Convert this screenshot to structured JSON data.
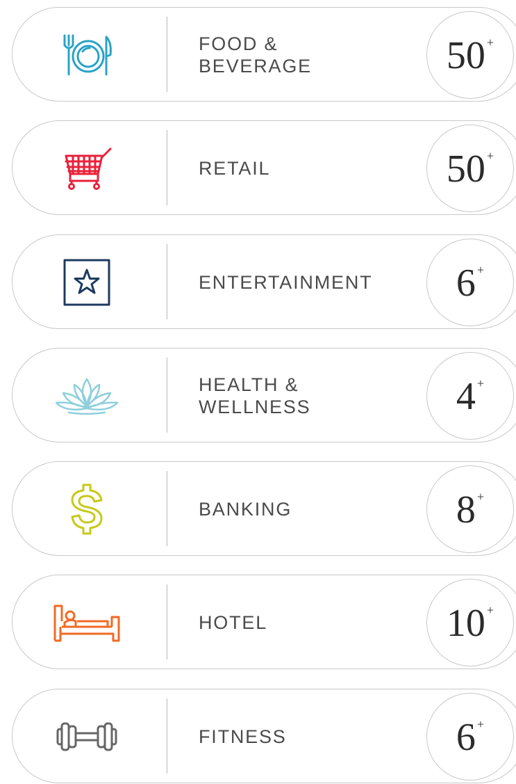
{
  "categories": [
    {
      "label_line1": "FOOD &",
      "label_line2": "BEVERAGE",
      "count": "50",
      "plus": "+",
      "icon": "plate-fork-knife-icon",
      "icon_color": "#2aa3c6"
    },
    {
      "label_line1": "RETAIL",
      "label_line2": "",
      "count": "50",
      "plus": "+",
      "icon": "shopping-cart-icon",
      "icon_color": "#e8213a"
    },
    {
      "label_line1": "ENTERTAINMENT",
      "label_line2": "",
      "count": "6",
      "plus": "+",
      "icon": "star-icon",
      "icon_color": "#1d3a5f"
    },
    {
      "label_line1": "HEALTH &",
      "label_line2": "WELLNESS",
      "count": "4",
      "plus": "+",
      "icon": "lotus-icon",
      "icon_color": "#8ecfdc"
    },
    {
      "label_line1": "BANKING",
      "label_line2": "",
      "count": "8",
      "plus": "+",
      "icon": "dollar-sign-icon",
      "icon_color": "#c7c91a"
    },
    {
      "label_line1": "HOTEL",
      "label_line2": "",
      "count": "10",
      "plus": "+",
      "icon": "bed-icon",
      "icon_color": "#f26a24"
    },
    {
      "label_line1": "FITNESS",
      "label_line2": "",
      "count": "6",
      "plus": "+",
      "icon": "dumbbell-icon",
      "icon_color": "#666666"
    }
  ]
}
